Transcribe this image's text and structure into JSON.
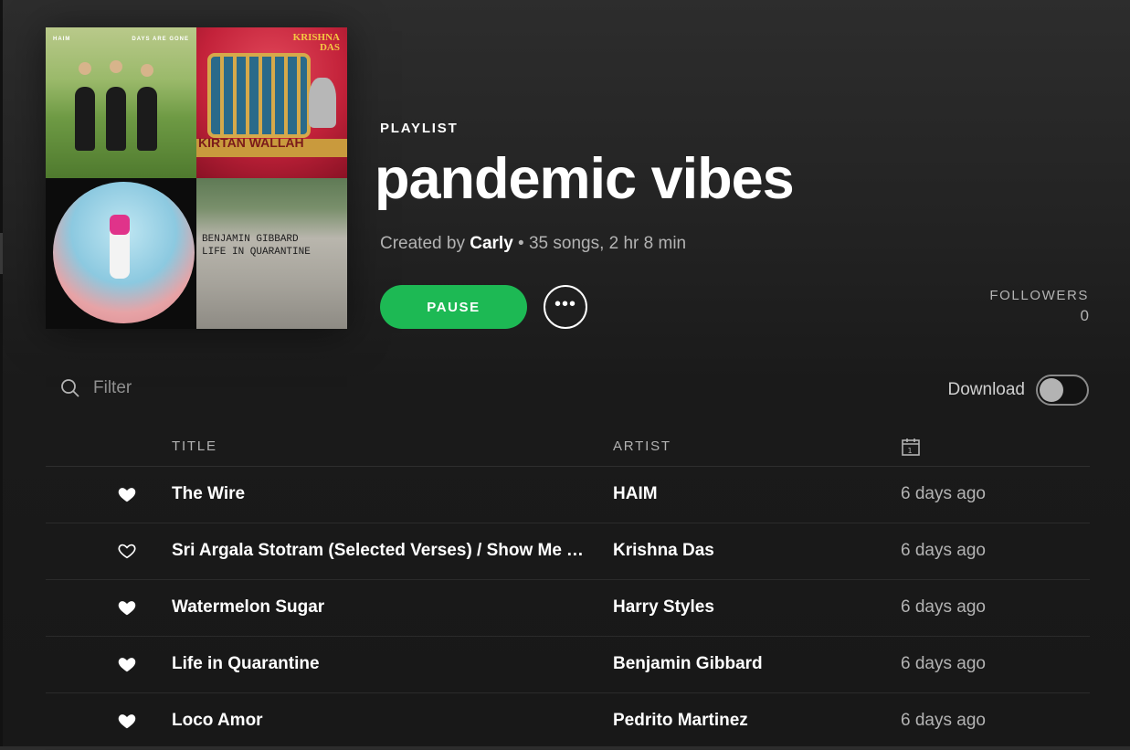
{
  "playlist": {
    "type_label": "PLAYLIST",
    "title": "pandemic vibes",
    "created_by_prefix": "Created by",
    "owner": "Carly",
    "stats": "• 35 songs, 2 hr 8 min"
  },
  "cover": {
    "tile1": {
      "artist": "HAIM",
      "album": "DAYS ARE GONE"
    },
    "tile2": {
      "artist_line1": "KRISHNA",
      "artist_line2": "DAS",
      "title": "KIRTAN WALLAH"
    },
    "tile4": {
      "text": "BENJAMIN GIBBARD\nLIFE IN QUARANTINE"
    }
  },
  "controls": {
    "pause_label": "PAUSE",
    "more_icon": "more-horizontal-icon",
    "followers_label": "FOLLOWERS",
    "followers_count": "0",
    "filter_placeholder": "Filter",
    "download_label": "Download",
    "download_enabled": false
  },
  "table": {
    "columns": {
      "title": "TITLE",
      "artist": "ARTIST",
      "date_icon": "calendar-icon"
    },
    "rows": [
      {
        "liked": true,
        "title": "The Wire",
        "artist": "HAIM",
        "added": "6 days ago"
      },
      {
        "liked": false,
        "title": "Sri Argala Stotram (Selected Verses) / Show Me Your Way",
        "artist": "Krishna Das",
        "added": "6 days ago"
      },
      {
        "liked": true,
        "title": "Watermelon Sugar",
        "artist": "Harry Styles",
        "added": "6 days ago"
      },
      {
        "liked": true,
        "title": "Life in Quarantine",
        "artist": "Benjamin Gibbard",
        "added": "6 days ago"
      },
      {
        "liked": true,
        "title": "Loco Amor",
        "artist": "Pedrito Martinez",
        "added": "6 days ago"
      }
    ]
  },
  "colors": {
    "accent": "#1db954",
    "background": "#181818",
    "muted_text": "#b3b3b3"
  }
}
